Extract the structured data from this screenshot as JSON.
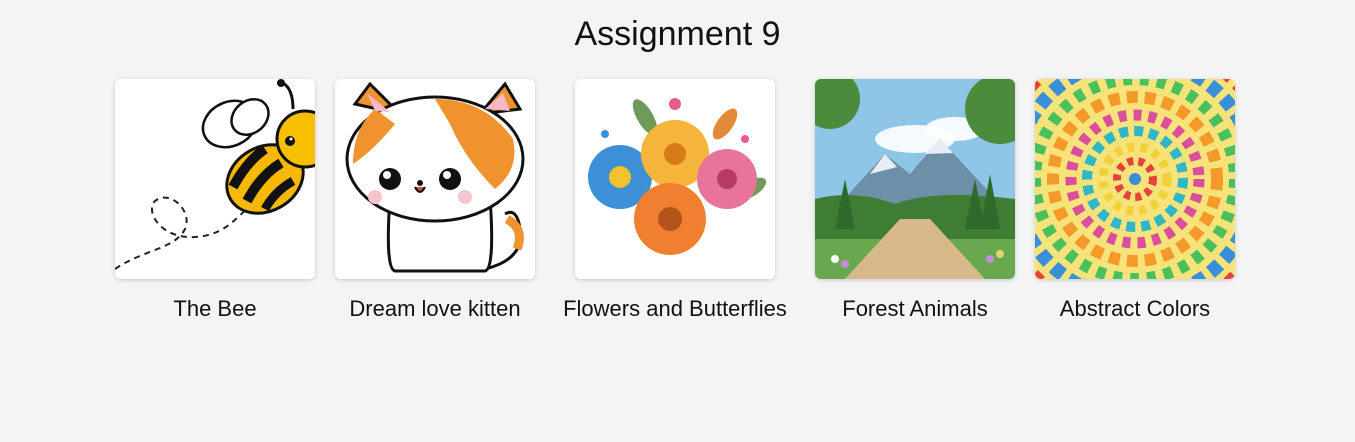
{
  "page": {
    "title": "Assignment 9"
  },
  "gallery": {
    "items": [
      {
        "label": "The Bee",
        "icon": "bee-illustration"
      },
      {
        "label": "Dream love kitten",
        "icon": "kitten-illustration"
      },
      {
        "label": "Flowers and Butterflies",
        "icon": "flower-bouquet-illustration"
      },
      {
        "label": "Forest Animals",
        "icon": "forest-landscape-illustration"
      },
      {
        "label": "Abstract Colors",
        "icon": "abstract-swirl-illustration"
      }
    ]
  }
}
